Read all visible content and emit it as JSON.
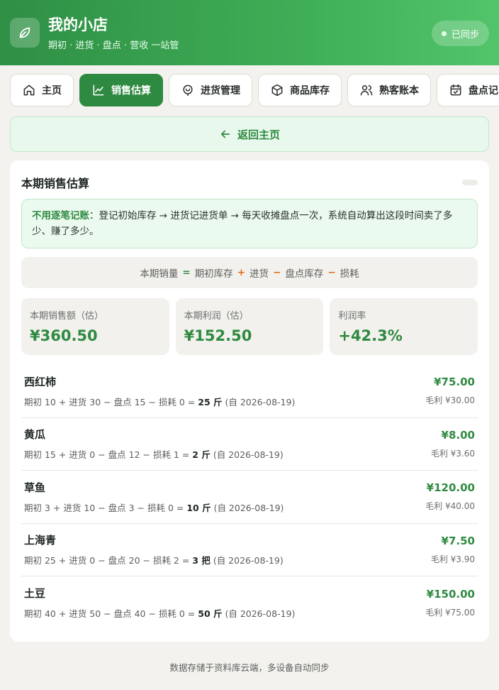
{
  "header": {
    "title": "我的小店",
    "subtitle": "期初 · 进货 · 盘点 · 营收 一站管",
    "sync_label": "已同步"
  },
  "tabs": [
    {
      "label": "主页",
      "icon": "home-icon",
      "active": false
    },
    {
      "label": "销售估算",
      "icon": "chart-line-icon",
      "active": true
    },
    {
      "label": "进货管理",
      "icon": "shopping-bag-icon",
      "active": false
    },
    {
      "label": "商品库存",
      "icon": "box-icon",
      "active": false
    },
    {
      "label": "熟客账本",
      "icon": "users-icon",
      "active": false
    },
    {
      "label": "盘点记",
      "icon": "calendar-check-icon",
      "active": false
    }
  ],
  "back": {
    "label": "返回主页"
  },
  "card": {
    "title": "本期销售估算",
    "info_bold": "不用逐笔记账",
    "info_text": "：登记初始库存 → 进货记进货单 → 每天收摊盘点一次，系统自动算出这段时间卖了多少、赚了多少。",
    "formula": {
      "term1": "本期销量",
      "eq": "=",
      "term2": "期初库存",
      "plus": "+",
      "term3": "进货",
      "minus1": "−",
      "term4": "盘点库存",
      "minus2": "−",
      "term5": "损耗"
    },
    "stats": [
      {
        "label": "本期销售额（估）",
        "value": "¥360.50"
      },
      {
        "label": "本期利润（估）",
        "value": "¥152.50"
      },
      {
        "label": "利润率",
        "value": "+42.3%"
      }
    ],
    "items": [
      {
        "name": "西红柿",
        "calc": "期初 10 + 进货 30 − 盘点 15 − 损耗 0 = ",
        "qty": "25 斤",
        "since": " (自 2026-08-19)",
        "amount": "¥75.00",
        "gross": "毛利 ¥30.00"
      },
      {
        "name": "黄瓜",
        "calc": "期初 15 + 进货 0 − 盘点 12 − 损耗 1 = ",
        "qty": "2 斤",
        "since": " (自 2026-08-19)",
        "amount": "¥8.00",
        "gross": "毛利 ¥3.60"
      },
      {
        "name": "草鱼",
        "calc": "期初 3 + 进货 10 − 盘点 3 − 损耗 0 = ",
        "qty": "10 斤",
        "since": " (自 2026-08-19)",
        "amount": "¥120.00",
        "gross": "毛利 ¥40.00"
      },
      {
        "name": "上海青",
        "calc": "期初 25 + 进货 0 − 盘点 20 − 损耗 2 = ",
        "qty": "3 把",
        "since": " (自 2026-08-19)",
        "amount": "¥7.50",
        "gross": "毛利 ¥3.90"
      },
      {
        "name": "土豆",
        "calc": "期初 40 + 进货 50 − 盘点 40 − 损耗 0 = ",
        "qty": "50 斤",
        "since": " (自 2026-08-19)",
        "amount": "¥150.00",
        "gross": "毛利 ¥75.00"
      }
    ]
  },
  "footer": {
    "note": "数据存储于资料库云端，多设备自动同步"
  },
  "colors": {
    "brand": "#2f8a41",
    "accent_orange": "#e36a1f",
    "background": "#f4f2ee"
  }
}
